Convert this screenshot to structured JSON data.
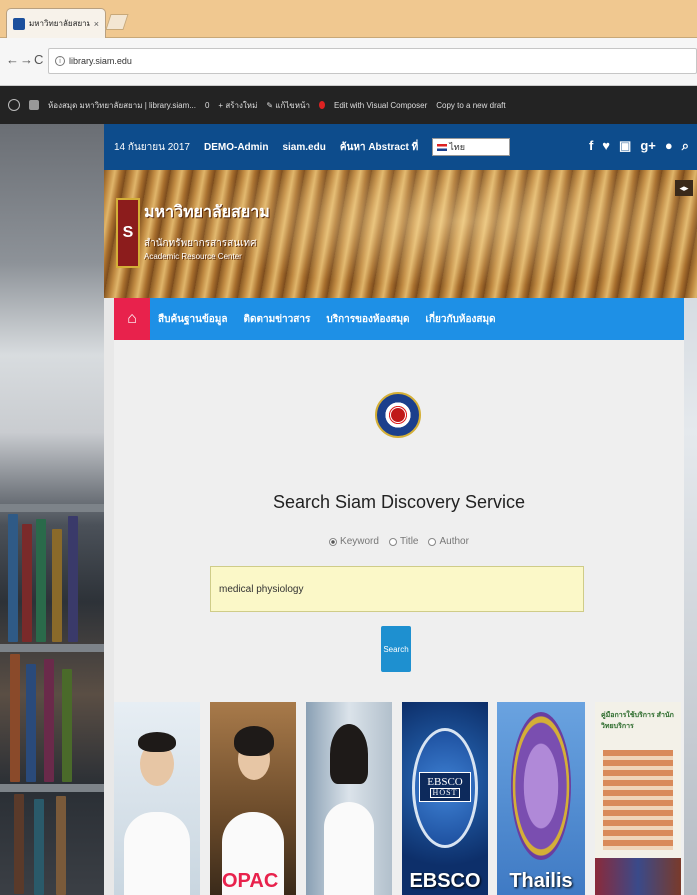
{
  "browser": {
    "tab_title": "มหาวิทยาลัยสยาม | ห้องสมุ...",
    "tab_close": "×",
    "back": "←",
    "forward": "→",
    "reload": "C",
    "url": "library.siam.edu"
  },
  "wp_toolbar": {
    "site_name": "ห้องสมุด มหาวิทยาลัยสยาม | library.siam...",
    "comments_count": "0",
    "new_label": "+ สร้างใหม่",
    "edit_label": "✎ แก้ไขหน้า",
    "visual_composer": "Edit with Visual Composer",
    "copy_draft": "Copy to a new draft"
  },
  "topbar": {
    "date": "14 กันยายน 2017",
    "admin": "DEMO-Admin",
    "site": "siam.edu",
    "abstract": "ค้นหา Abstract ที่",
    "language": "ไทย",
    "social_icons": [
      "f",
      "t",
      "You",
      "g+",
      "flickr",
      "search"
    ]
  },
  "banner": {
    "university": "มหาวิทยาลัยสยาม",
    "office": "สำนักทรัพยากรสารสนเทศ",
    "subtitle": "Academic Resource Center",
    "arrows": "◂▸"
  },
  "nav": {
    "home_icon": "home-icon",
    "items": [
      "สืบค้นฐานข้อมูล",
      "ติดตามข่าวสาร",
      "บริการของห้องสมุด",
      "เกี่ยวกับห้องสมุด"
    ]
  },
  "search": {
    "title": "Search Siam Discovery Service",
    "options": [
      "Keyword",
      "Title",
      "Author"
    ],
    "selected": "Keyword",
    "query": "medical physiology",
    "button": "Search"
  },
  "tiles": {
    "opac": "OPAC",
    "ebsco_top": "EBSCO",
    "ebsco_host": "HOST",
    "ebsco_caption": "EBSCO",
    "thailis_caption": "Thailis",
    "library_title": "คู่มือการใช้บริการ สำนักวิทยบริการ"
  },
  "colors": {
    "topbar": "#0d4c8c",
    "nav": "#1e90e6",
    "home": "#e8224c",
    "search_box": "#fbf8c8",
    "search_button": "#1e90d0"
  }
}
